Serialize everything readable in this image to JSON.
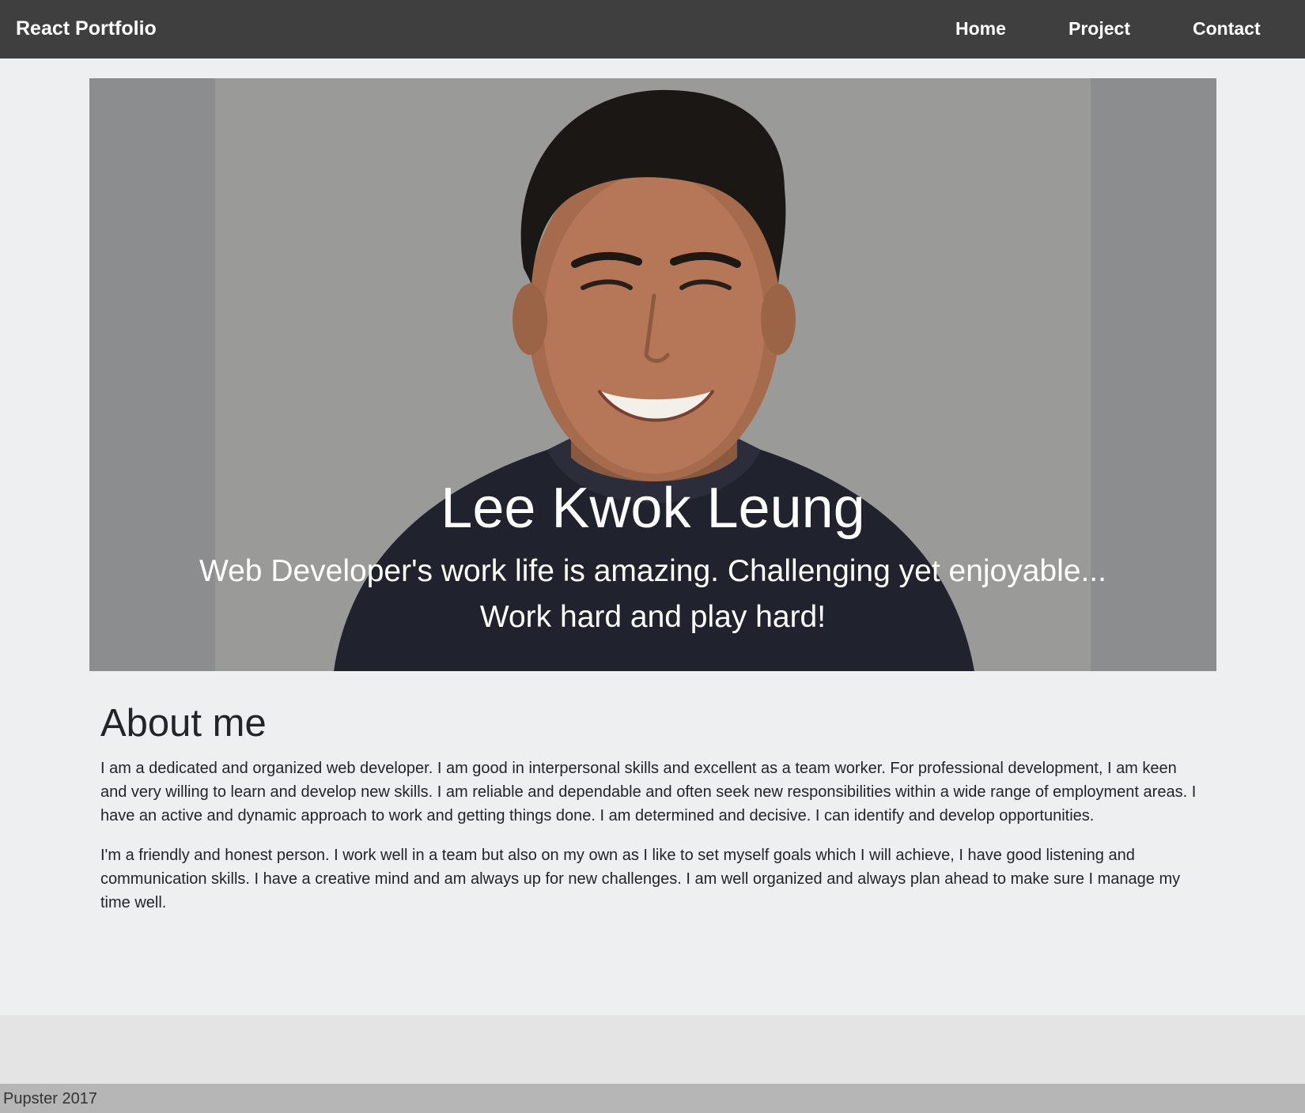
{
  "navbar": {
    "brand": "React Portfolio",
    "links": [
      "Home",
      "Project",
      "Contact"
    ]
  },
  "hero": {
    "title": "Lee Kwok Leung",
    "subtitle_line1": "Web Developer's work life is amazing. Challenging yet enjoyable...",
    "subtitle_line2": "Work hard and play hard!"
  },
  "about": {
    "heading": "About me",
    "paragraphs": [
      "I am a dedicated and organized web developer. I am good in interpersonal skills and excellent as a team worker. For professional development, I am keen and very willing to learn and develop new skills. I am reliable and dependable and often seek new responsibilities within a wide range of employment areas. I have an active and dynamic approach to work and getting things done. I am determined and decisive. I can identify and develop opportunities.",
      "I'm a friendly and honest person. I work well in a team but also on my own as I like to set myself goals which I will achieve, I have good listening and communication skills. I have a creative mind and am always up for new challenges. I am well organized and always plan ahead to make sure I manage my time well."
    ]
  },
  "footer": {
    "text": "Pupster 2017"
  },
  "colors": {
    "navbar_bg": "#3f3f3f",
    "page_bg": "#eeeff1",
    "hero_side_bg": "#8c8d8f",
    "hero_photo_bg": "#9a9a99",
    "footer_area_bg": "#e4e4e4",
    "footer_bar_bg": "#b6b6b6"
  }
}
